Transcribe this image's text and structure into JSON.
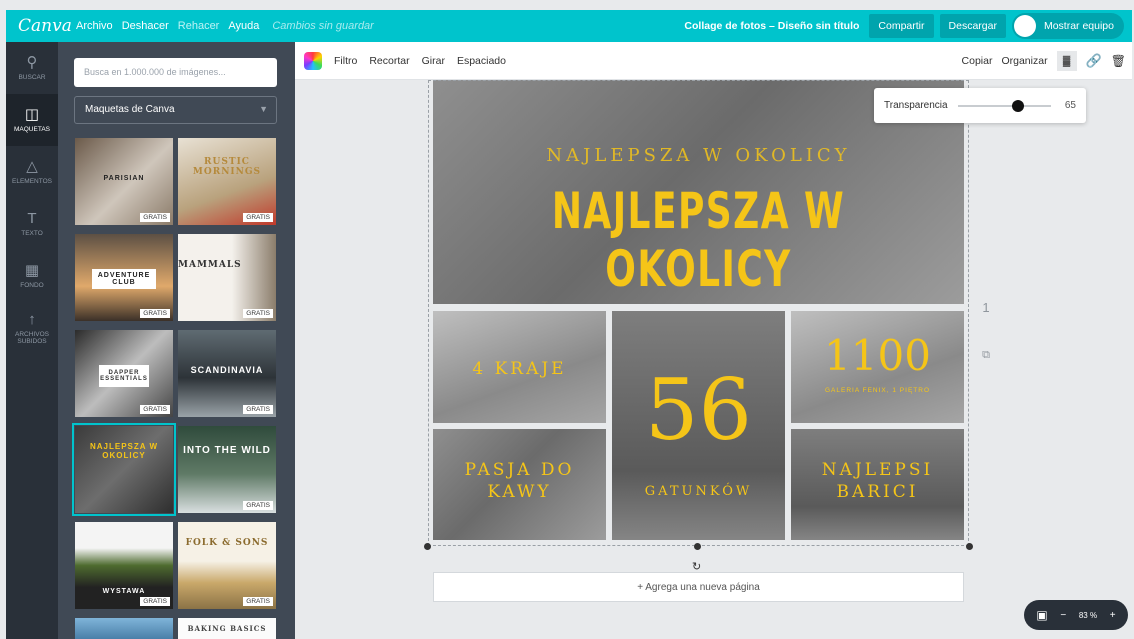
{
  "app": {
    "logo": "Canva"
  },
  "menu": {
    "file": "Archivo",
    "undo": "Deshacer",
    "redo": "Rehacer",
    "help": "Ayuda",
    "status": "Cambios sin guardar"
  },
  "header": {
    "doc_title": "Collage de fotos – Diseño sin título",
    "share": "Compartir",
    "download": "Descargar",
    "team": "Mostrar equipo"
  },
  "rail": [
    {
      "label": "BUSCAR",
      "icon": "search-icon"
    },
    {
      "label": "MAQUETAS",
      "icon": "layout-icon"
    },
    {
      "label": "ELEMENTOS",
      "icon": "shapes-icon"
    },
    {
      "label": "TEXTO",
      "icon": "text-icon"
    },
    {
      "label": "FONDO",
      "icon": "background-icon"
    },
    {
      "label": "ARCHIVOS SUBIDOS",
      "icon": "upload-icon"
    }
  ],
  "panel": {
    "search_placeholder": "Busca en 1.000.000 de imágenes...",
    "select": "Maquetas de Canva"
  },
  "thumbs": [
    {
      "title": "PARISIAN",
      "badge": "GRATIS"
    },
    {
      "title": "RUSTIC MORNINGS",
      "badge": "GRATIS"
    },
    {
      "title": "ADVENTURE CLUB",
      "badge": "GRATIS"
    },
    {
      "title": "MAMMALS",
      "badge": "GRATIS"
    },
    {
      "title": "DAPPER ESSENTIALS",
      "badge": "GRATIS"
    },
    {
      "title": "SCANDINAVIA",
      "badge": "GRATIS"
    },
    {
      "title": "NAJLEPSZA W OKOLICY",
      "badge": ""
    },
    {
      "title": "INTO THE WILD",
      "badge": "GRATIS"
    },
    {
      "title": "WYSTAWA",
      "badge": "GRATIS"
    },
    {
      "title": "FOLK & SONS",
      "badge": "GRATIS"
    },
    {
      "title": "",
      "badge": ""
    },
    {
      "title": "BAKING BASICS",
      "badge": ""
    }
  ],
  "toolbar": {
    "filter": "Filtro",
    "crop": "Recortar",
    "flip": "Girar",
    "spacing": "Espaciado",
    "copy": "Copiar",
    "arrange": "Organizar"
  },
  "transparency": {
    "label": "Transparencia",
    "value": "65",
    "level": 0.65
  },
  "design": {
    "top_small": "NAJLEPSZA W OKOLICY",
    "top_big": "NAJLEPSZA W OKOLICY",
    "c1": "4 KRAJE",
    "big_num": "56",
    "c2_sub": "GATUNKÓW",
    "c3_num": "1100",
    "c3_sub": "GALERIA FENIX, 1 PIĘTRO",
    "c4": "PASJA DO KAWY",
    "c5": "NAJLEPSI BARICI"
  },
  "page_number": "1",
  "add_page": "+ Agrega una nueva página",
  "zoom": {
    "value": "83 %",
    "minus": "−",
    "plus": "+"
  },
  "colors": {
    "brand": "#00c4cc",
    "rail": "#293039",
    "panel": "#404955",
    "accent_text": "#f5c518"
  }
}
